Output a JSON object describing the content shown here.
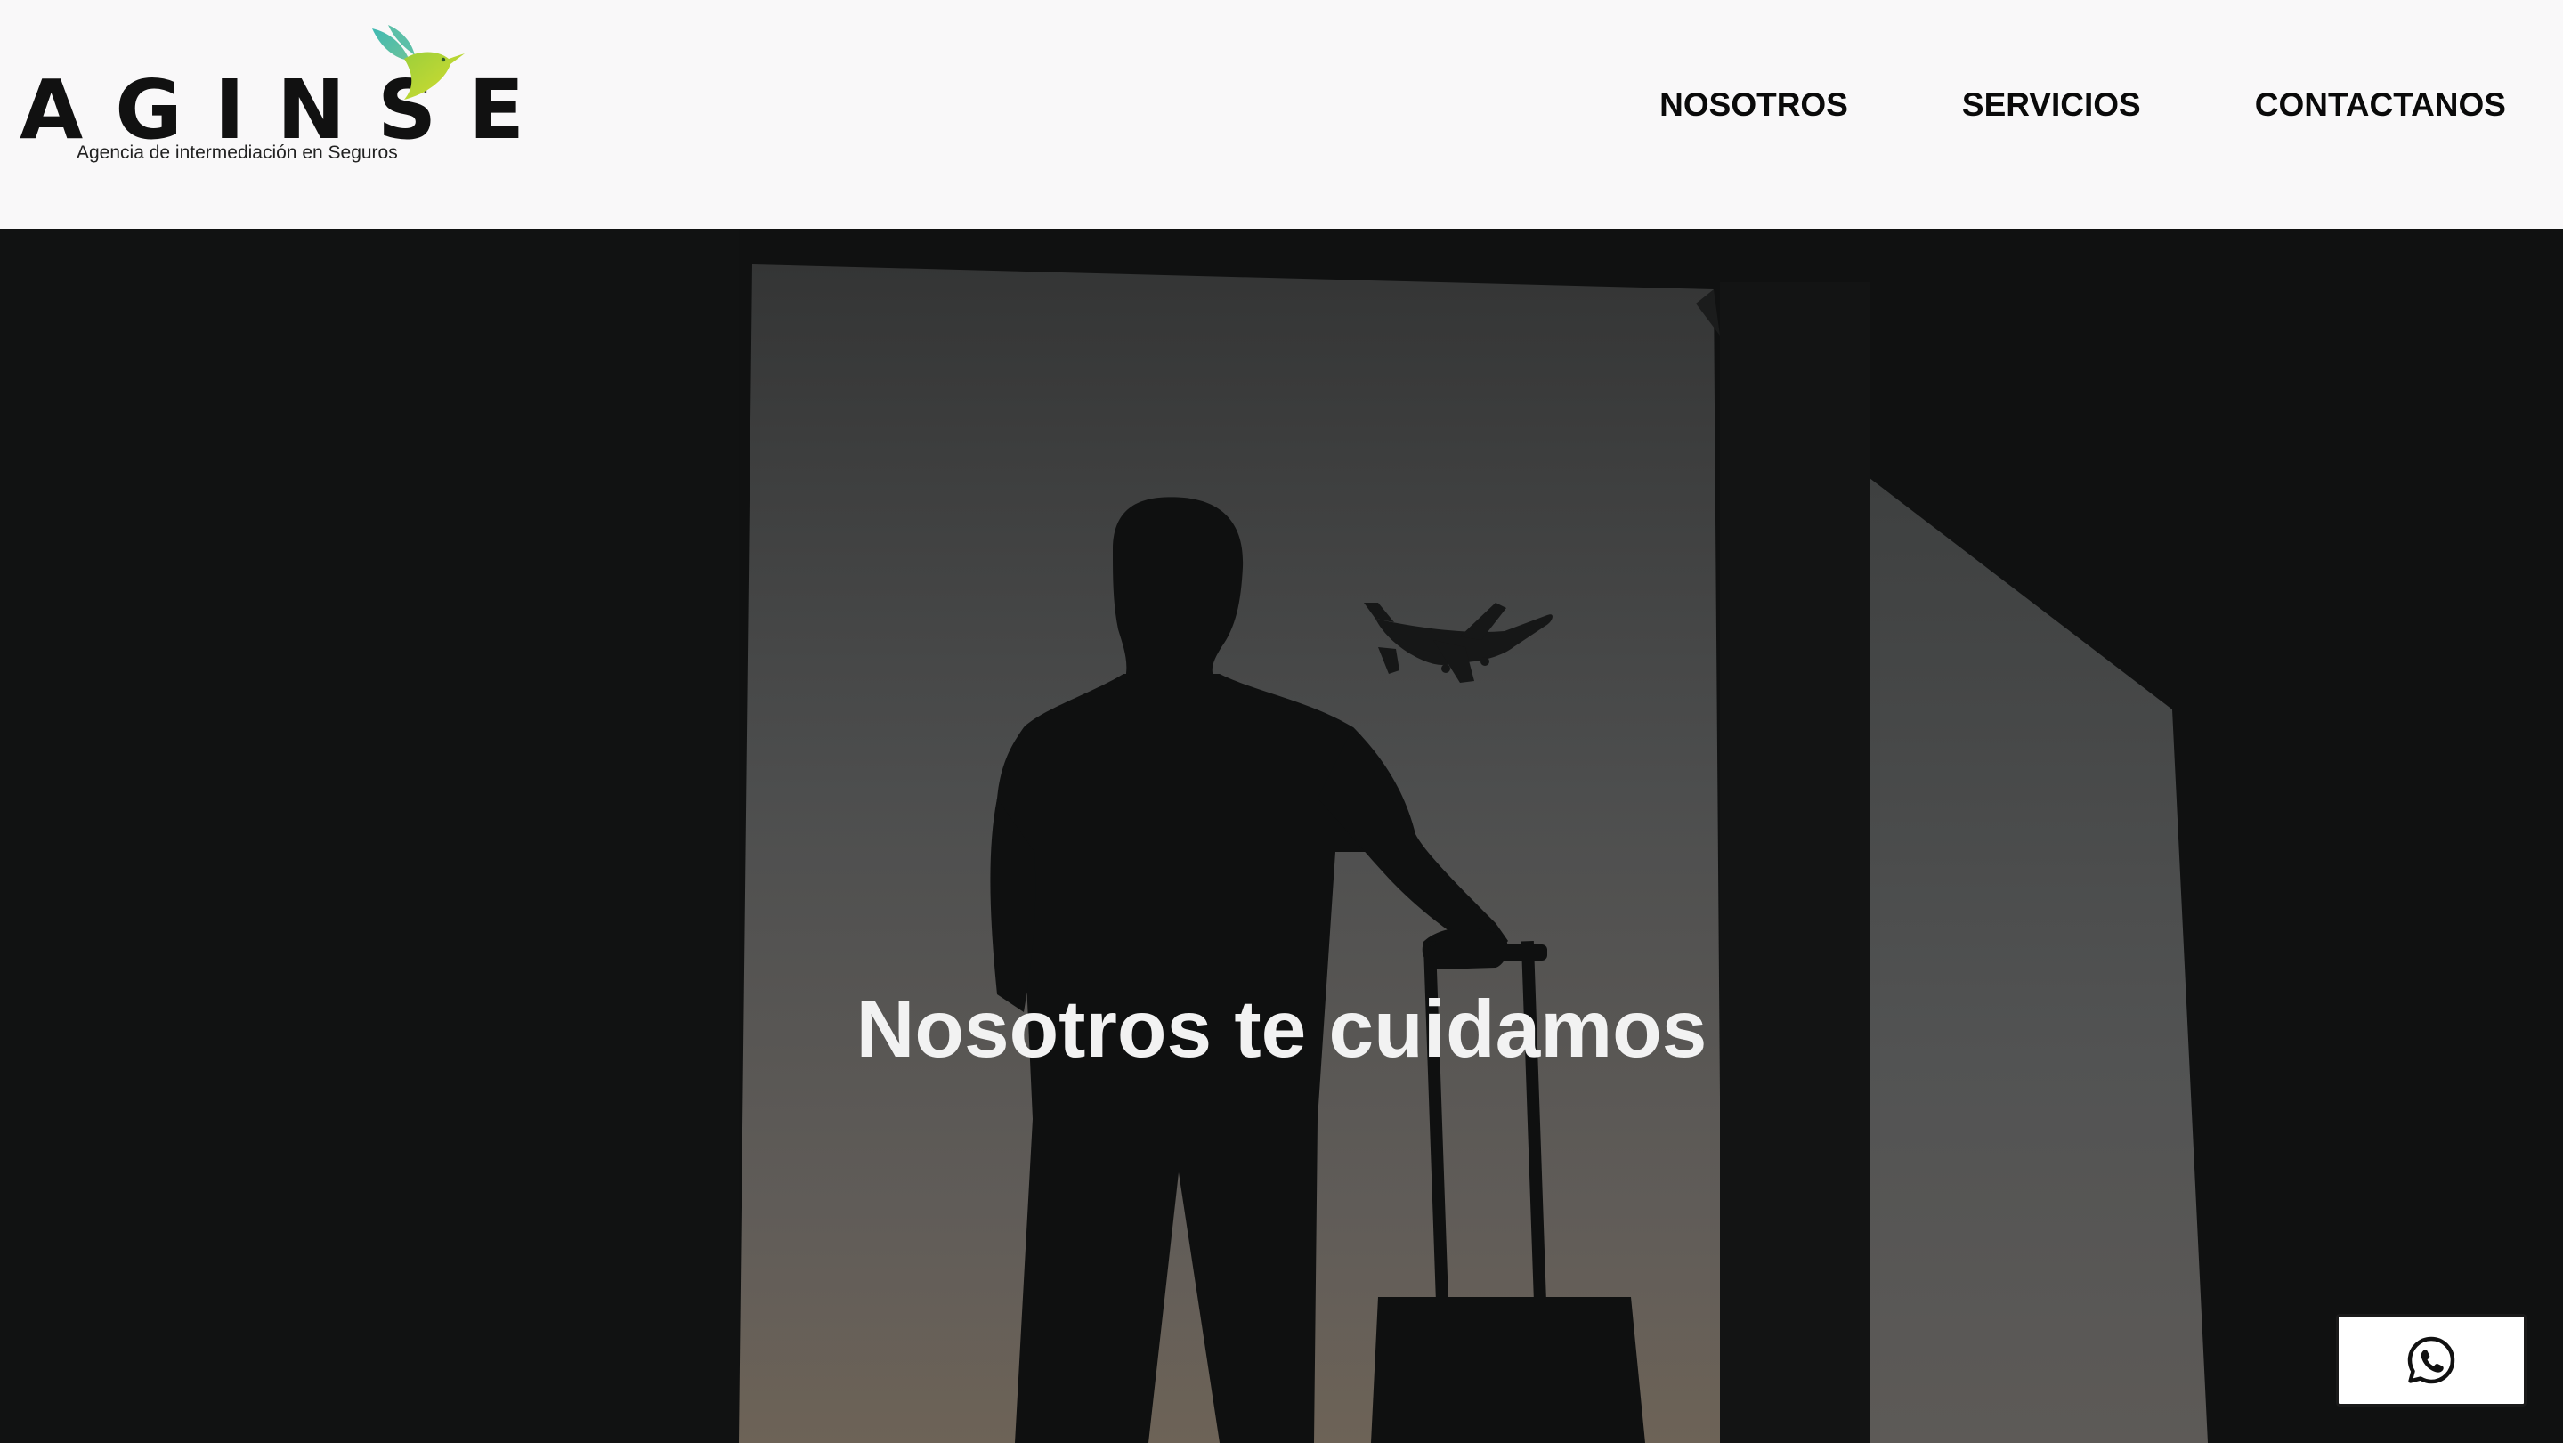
{
  "brand": {
    "name": "AGINSE",
    "tagline": "Agencia de intermediación en Seguros",
    "colors": {
      "bird_teal": "#3fb9b3",
      "bird_green": "#9ccf3b",
      "bird_yellow": "#d6dd2e"
    }
  },
  "nav": {
    "items": [
      {
        "label": "NOSOTROS"
      },
      {
        "label": "SERVICIOS"
      },
      {
        "label": "CONTACTANOS"
      }
    ]
  },
  "hero": {
    "heading": "Nosotros te cuidamos",
    "image_subject": "silhouette-traveler-with-suitcase-airplane"
  },
  "whatsapp": {
    "icon": "whatsapp-icon"
  },
  "colors": {
    "header_bg": "#f9f8f9",
    "nav_text": "#0a0a0a",
    "hero_text": "#f2f2f2",
    "hero_dark": "#101111"
  }
}
